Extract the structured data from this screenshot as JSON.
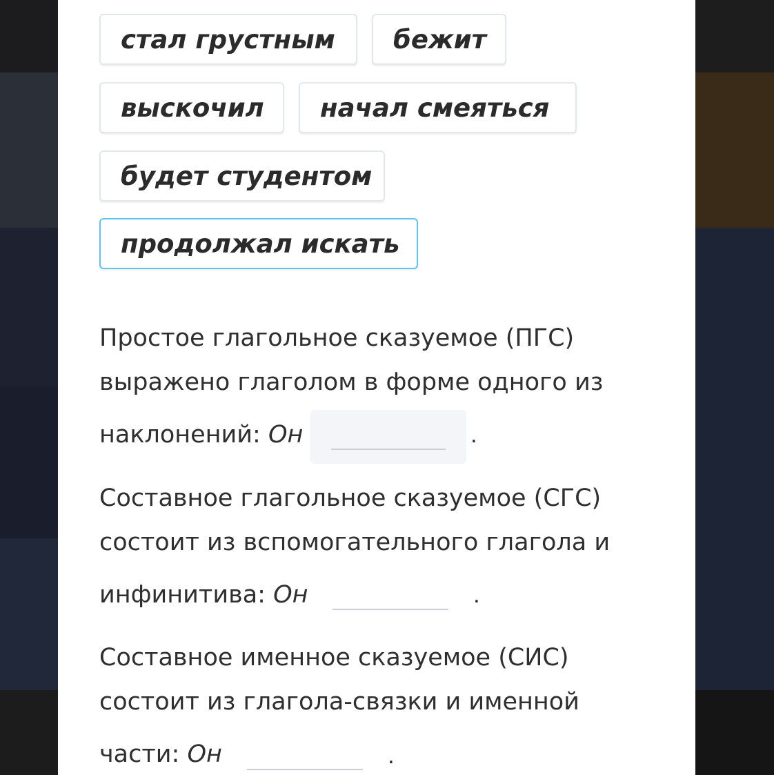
{
  "word_bank": [
    {
      "label": "стал грустным",
      "selected": false
    },
    {
      "label": "бежит",
      "selected": false
    },
    {
      "label": "выскочил",
      "selected": false
    },
    {
      "label": "начал смеяться",
      "selected": false
    },
    {
      "label": "будет студентом",
      "selected": false
    },
    {
      "label": "продолжал искать",
      "selected": true
    }
  ],
  "statements": [
    {
      "line1": "Простое глагольное сказуемое (ПГС)",
      "line2": "выражено глаголом в форме одного из",
      "line3_prefix": "наклонений:",
      "pronoun": "Он",
      "end": ".",
      "blank_value": "",
      "blank_active": true
    },
    {
      "line1": "Составное глагольное сказуемое (СГС)",
      "line2": "состоит из вспомогательного глагола и",
      "line3_prefix": "инфинитива:",
      "pronoun": "Он",
      "end": ".",
      "blank_value": "",
      "blank_active": false
    },
    {
      "line1": "Составное именное сказуемое (СИС)",
      "line2": "состоит из глагола-связки и именной",
      "line3_prefix": "части:",
      "pronoun": "Он",
      "end": ".",
      "blank_value": "",
      "blank_active": false
    }
  ],
  "colors": {
    "chip_border": "#e3e6eb",
    "chip_selected_border": "#5fc3ef",
    "blank_active_bg": "#f3f5f8",
    "text": "#2f2f2f"
  }
}
